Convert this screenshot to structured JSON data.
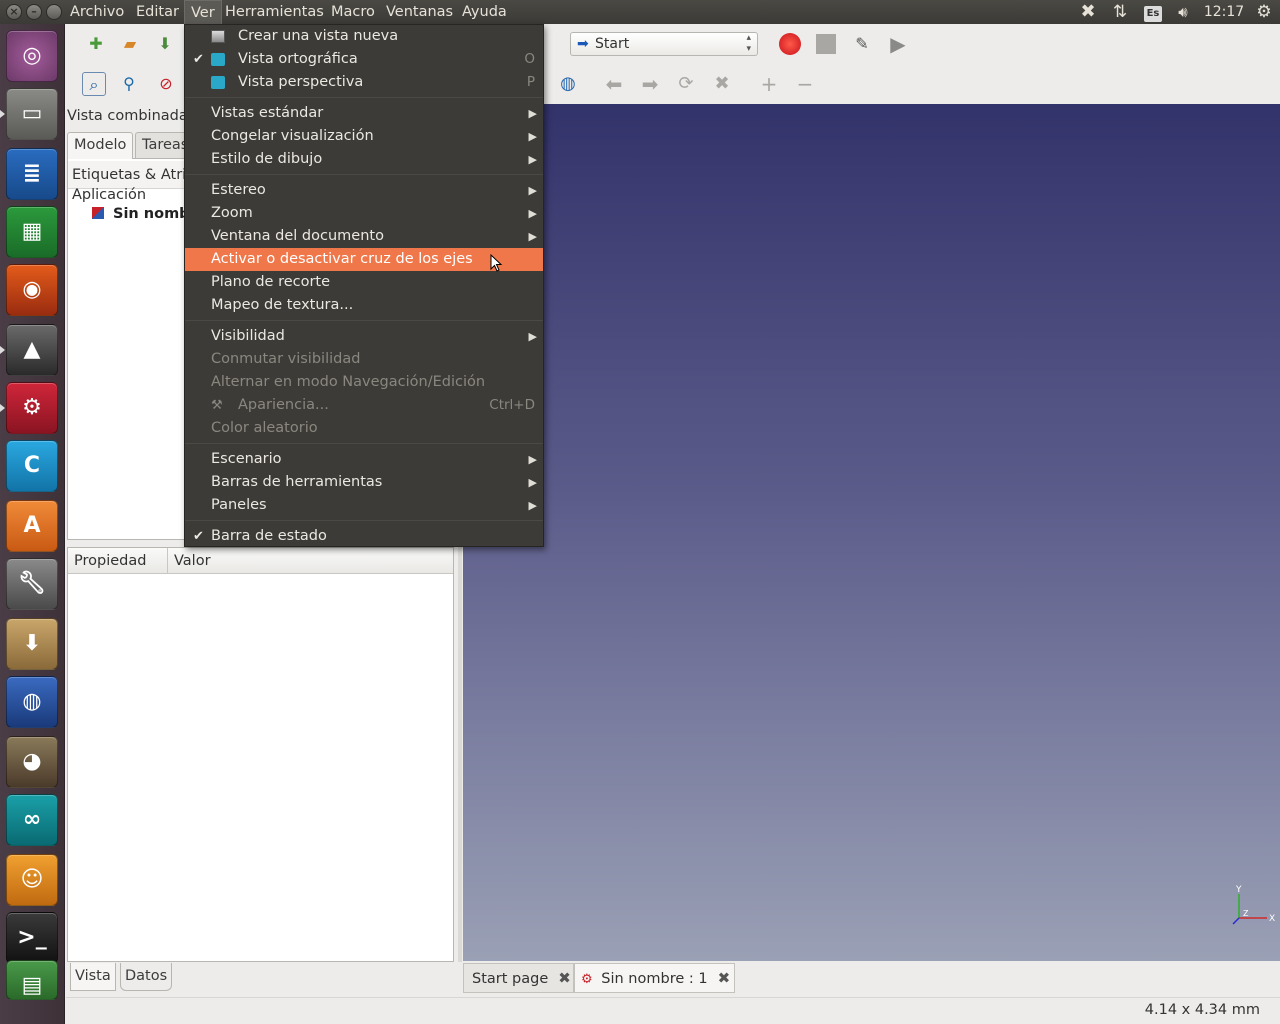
{
  "menubar": {
    "items": [
      "Archivo",
      "Editar",
      "Ver",
      "Herramientas",
      "Macro",
      "Ventanas",
      "Ayuda"
    ],
    "active": "Ver"
  },
  "tray": {
    "keyboard": "Es",
    "clock": "12:17"
  },
  "toolbar": {
    "workbench": "Start"
  },
  "left_panel": {
    "title": "Vista combinada",
    "tabs": [
      "Modelo",
      "Tareas"
    ],
    "tree_header": "Etiquetas & Atrib",
    "tree_root": "Aplicación",
    "tree_doc": "Sin nombr",
    "prop_headers": [
      "Propiedad",
      "Valor"
    ],
    "bottom_tabs": [
      "Vista",
      "Datos"
    ]
  },
  "mdi_tabs": [
    "Start page",
    "Sin nombre : 1"
  ],
  "status": {
    "dimensions": "4.14 x 4.34 mm"
  },
  "axis": {
    "x": "X",
    "y": "Y",
    "z": "Z"
  },
  "ver_menu": {
    "crear_vista": "Crear una vista nueva",
    "orto": "Vista ortográfica",
    "orto_shortcut": "O",
    "persp": "Vista perspectiva",
    "persp_shortcut": "P",
    "vistas_estandar": "Vistas estándar",
    "congelar": "Congelar visualización",
    "estilo": "Estilo de dibujo",
    "estereo": "Estereo",
    "zoom": "Zoom",
    "ventana_doc": "Ventana del documento",
    "cruz_ejes": "Activar o desactivar cruz de los ejes",
    "plano_recorte": "Plano de recorte",
    "mapeo": "Mapeo de textura...",
    "visibilidad": "Visibilidad",
    "conmutar": "Conmutar visibilidad",
    "alternar": "Alternar en modo Navegación/Edición",
    "apariencia": "Apariencia...",
    "apariencia_shortcut": "Ctrl+D",
    "color_aleatorio": "Color aleatorio",
    "escenario": "Escenario",
    "barras": "Barras de herramientas",
    "paneles": "Paneles",
    "barra_estado": "Barra de estado"
  }
}
